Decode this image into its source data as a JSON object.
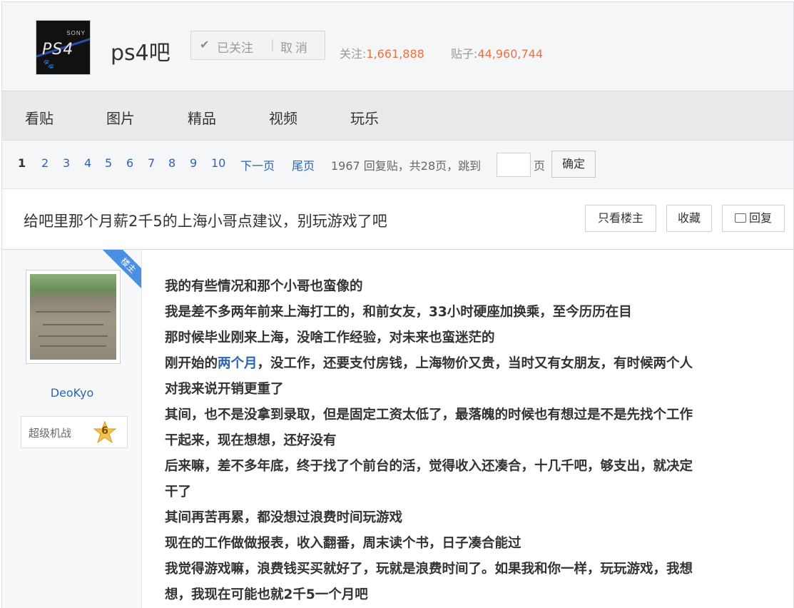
{
  "forum": {
    "name": "ps4吧",
    "logo_text": "PS4",
    "logo_brand": "SONY",
    "followed_label": "已关注",
    "cancel_label": "取消",
    "follow_label": "关注:",
    "follow_count": "1,661,888",
    "posts_label": "贴子:",
    "posts_count": "44,960,744"
  },
  "nav": [
    "看贴",
    "图片",
    "精品",
    "视频",
    "玩乐"
  ],
  "pager": {
    "pages": [
      "1",
      "2",
      "3",
      "4",
      "5",
      "6",
      "7",
      "8",
      "9",
      "10"
    ],
    "current": "1",
    "next": "下一页",
    "last": "尾页",
    "summary": "1967 回复贴，共28页，跳到",
    "page_unit": "页",
    "confirm": "确定"
  },
  "thread": {
    "title": "给吧里那个月薪2千5的上海小哥点建议，别玩游戏了吧",
    "only_op": "只看楼主",
    "favorite": "收藏",
    "reply": "回复"
  },
  "post": {
    "badge": "楼主",
    "author": "DeoKyo",
    "rank_title": "超级机战",
    "level": "6",
    "lines": [
      {
        "text": "我的有些情况和那个小哥也蛮像的"
      },
      {
        "text": "我是差不多两年前来上海打工的，和前女友，33小时硬座加换乘，至今历历在目"
      },
      {
        "text": "那时候毕业刚来上海，没啥工作经验，对未来也蛮迷茫的"
      },
      {
        "pre": "刚开始的",
        "highlight": "两个月",
        "post": "，没工作，还要支付房钱，上海物价又贵，当时又有女朋友，有时候两个人"
      },
      {
        "text": "对我来说开销更重了"
      },
      {
        "text": "其间，也不是没拿到录取，但是固定工资太低了，最落魄的时候也有想过是不是先找个工作"
      },
      {
        "text": "干起来，现在想想，还好没有"
      },
      {
        "text": "后来嘛，差不多年底，终于找了个前台的活，觉得收入还凑合，十几千吧，够支出，就决定"
      },
      {
        "text": "干了"
      },
      {
        "text": "其间再苦再累，都没想过浪费时间玩游戏"
      },
      {
        "text": "现在的工作做做报表，收入翻番，周末读个书，日子凑合能过"
      },
      {
        "text": "我觉得游戏嘛，浪费钱买买就好了，玩就是浪费时间了。如果我和你一样，玩玩游戏，我想"
      },
      {
        "text": "想，我现在可能也就2千5一个月吧"
      }
    ]
  },
  "colors": {
    "link": "#2d64b3",
    "count": "#f26e42",
    "badge": "#4a8fe2"
  }
}
